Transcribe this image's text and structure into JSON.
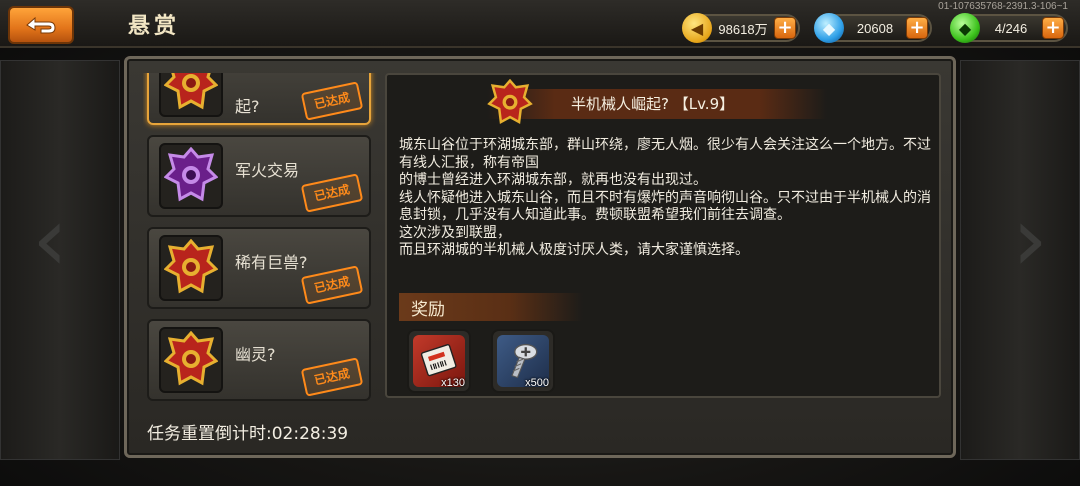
{
  "header": {
    "title": "悬赏",
    "debug_id": "01-107635768-2391.3-106~1"
  },
  "resources": {
    "gold": {
      "value": "98618万",
      "icon": "gold-coin-icon"
    },
    "crystal": {
      "value": "20608",
      "icon": "blue-crystal-icon"
    },
    "energy": {
      "value": "4/246",
      "icon": "green-gem-icon"
    }
  },
  "bounties": [
    {
      "name": "起?",
      "status": "已达成",
      "selected": true
    },
    {
      "name": "军火交易",
      "status": "已达成",
      "selected": false
    },
    {
      "name": "稀有巨兽?",
      "status": "已达成",
      "selected": false
    },
    {
      "name": "幽灵?",
      "status": "已达成",
      "selected": false
    }
  ],
  "detail": {
    "title": "半机械人崛起? 【Lv.9】",
    "description": "城东山谷位于环湖城东部，群山环绕，廖无人烟。很少有人会关注这么一个地方。不过有线人汇报，称有帝国\n的博士曾经进入环湖城东部，就再也没有出现过。\n线人怀疑他进入城东山谷，而且不时有爆炸的声音响彻山谷。只不过由于半机械人的消息封锁，几乎没有人知道此事。费顿联盟希望我们前往去调查。\n这次涉及到联盟，\n而且环湖城的半机械人极度讨厌人类，请大家谨慎选择。",
    "reward_label": "奖励",
    "rewards": [
      {
        "name": "ticket",
        "qty": "x130"
      },
      {
        "name": "screw",
        "qty": "x500"
      }
    ]
  },
  "footer": {
    "timer": "任务重置倒计时:02:28:39"
  },
  "colors": {
    "accent_orange": "#e2741a",
    "stamp_orange": "#ff8a1a",
    "selected_border": "#e7a43a"
  }
}
